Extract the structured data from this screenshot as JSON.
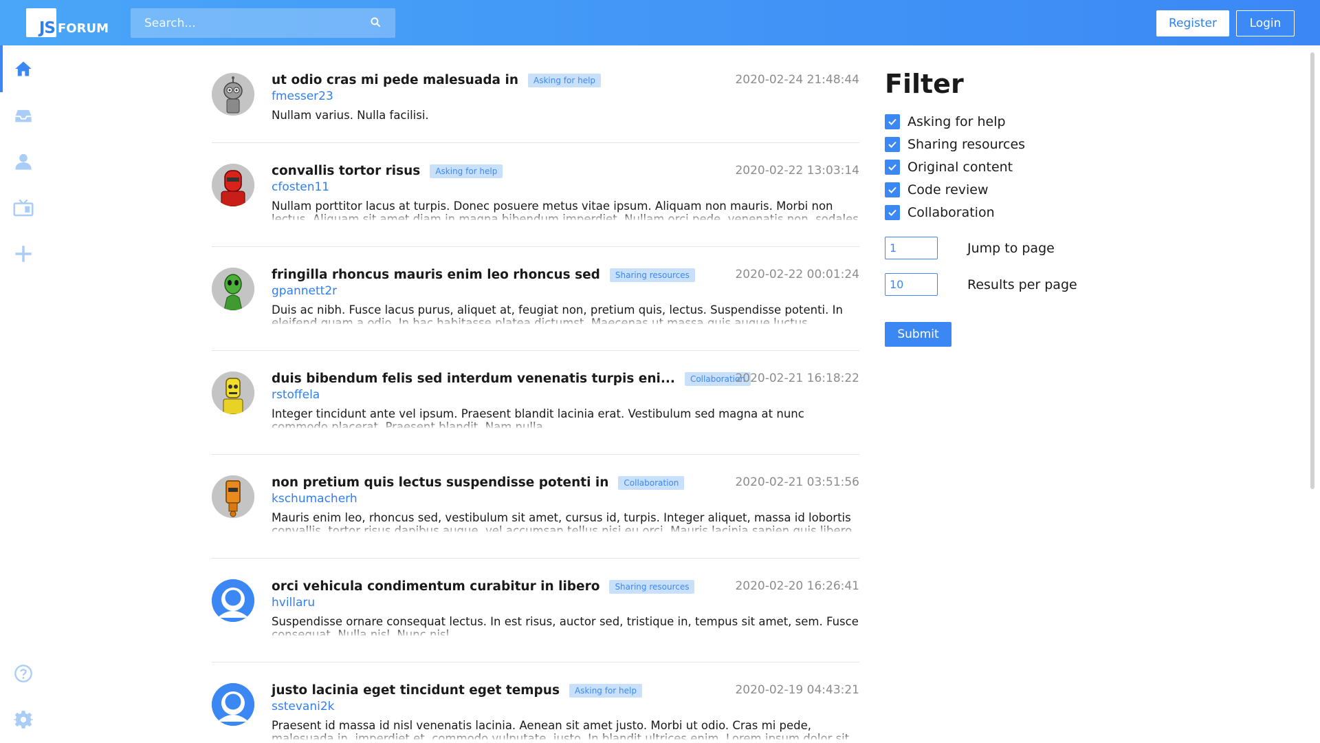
{
  "header": {
    "logo_js": "JS",
    "logo_forum": "FORUM",
    "search_placeholder": "Search...",
    "register_label": "Register",
    "login_label": "Login",
    "accent": "#3b88f5"
  },
  "sidebar": {
    "items": [
      {
        "icon": "home-icon",
        "active": true
      },
      {
        "icon": "inbox-icon",
        "active": false
      },
      {
        "icon": "user-icon",
        "active": false
      },
      {
        "icon": "tv-icon",
        "active": false
      },
      {
        "icon": "plus-icon",
        "active": false
      },
      {
        "icon": "help-icon",
        "active": false
      },
      {
        "icon": "gear-icon",
        "active": false
      }
    ]
  },
  "posts": [
    {
      "title": "ut odio cras mi pede malesuada in",
      "tag": "Asking for help",
      "user": "fmesser23",
      "date": "2020-02-24 21:48:44",
      "body": "Nullam varius. Nulla facilisi.",
      "avatar": "robot-gray"
    },
    {
      "title": "convallis tortor risus",
      "tag": "Asking for help",
      "user": "cfosten11",
      "date": "2020-02-22 13:03:14",
      "body": "Nullam porttitor lacus at turpis. Donec posuere metus vitae ipsum. Aliquam non mauris. Morbi non lectus. Aliquam sit amet diam in magna bibendum imperdiet. Nullam orci pede, venenatis non, sodales",
      "avatar": "robot-red"
    },
    {
      "title": "fringilla rhoncus mauris enim leo rhoncus sed",
      "tag": "Sharing resources",
      "user": "gpannett2r",
      "date": "2020-02-22 00:01:24",
      "body": "Duis ac nibh. Fusce lacus purus, aliquet at, feugiat non, pretium quis, lectus. Suspendisse potenti. In eleifend quam a odio. In hac habitasse platea dictumst. Maecenas ut massa quis augue luctus tincidunt.",
      "avatar": "robot-green"
    },
    {
      "title": "duis bibendum felis sed interdum venenatis turpis eni...",
      "tag": "Collaboration",
      "user": "rstoffela",
      "date": "2020-02-21 16:18:22",
      "body": "Integer tincidunt ante vel ipsum. Praesent blandit lacinia erat. Vestibulum sed magna at nunc commodo placerat. Praesent blandit. Nam nulla.",
      "avatar": "robot-yellow"
    },
    {
      "title": "non pretium quis lectus suspendisse potenti in",
      "tag": "Collaboration",
      "user": "kschumacherh",
      "date": "2020-02-21 03:51:56",
      "body": "Mauris enim leo, rhoncus sed, vestibulum sit amet, cursus id, turpis. Integer aliquet, massa id lobortis convallis, tortor risus dapibus augue, vel accumsan tellus nisi eu orci. Mauris lacinia sapien quis libero.",
      "avatar": "robot-orange"
    },
    {
      "title": "orci vehicula condimentum curabitur in libero",
      "tag": "Sharing resources",
      "user": "hvillaru",
      "date": "2020-02-20 16:26:41",
      "body": "Suspendisse ornare consequat lectus. In est risus, auctor sed, tristique in, tempus sit amet, sem. Fusce consequat. Nulla nisl. Nunc nisl.",
      "avatar": "default-user"
    },
    {
      "title": "justo lacinia eget tincidunt eget tempus",
      "tag": "Asking for help",
      "user": "sstevani2k",
      "date": "2020-02-19 04:43:21",
      "body": "Praesent id massa id nisl venenatis lacinia. Aenean sit amet justo. Morbi ut odio. Cras mi pede, malesuada in, imperdiet et, commodo vulputate, justo. In blandit ultrices enim. Lorem ipsum dolor sit",
      "avatar": "default-user"
    }
  ],
  "filter": {
    "title": "Filter",
    "options": [
      {
        "label": "Asking for help",
        "checked": true
      },
      {
        "label": "Sharing resources",
        "checked": true
      },
      {
        "label": "Original content",
        "checked": true
      },
      {
        "label": "Code review",
        "checked": true
      },
      {
        "label": "Collaboration",
        "checked": true
      }
    ],
    "jump_to_page": {
      "label": "Jump to page",
      "value": "1"
    },
    "results_per_page": {
      "label": "Results per page",
      "value": "10"
    },
    "submit_label": "Submit"
  }
}
